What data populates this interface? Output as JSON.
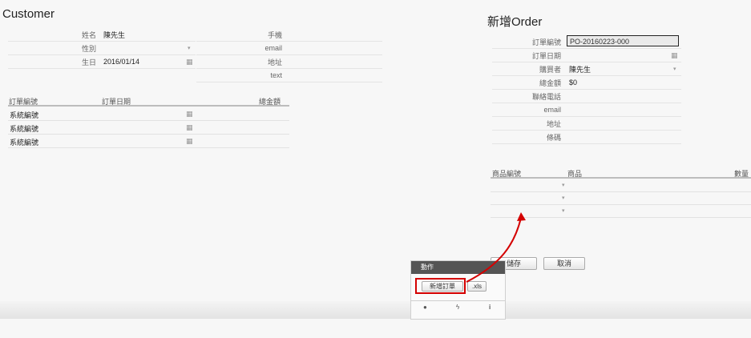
{
  "customer": {
    "title": "Customer",
    "fields_left": [
      {
        "label": "姓名",
        "value": "陳先生"
      },
      {
        "label": "性別",
        "value": ""
      },
      {
        "label": "生日",
        "value": "2016/01/14"
      }
    ],
    "fields_right": [
      "手機",
      "email",
      "地址",
      "text"
    ],
    "orders": {
      "columns": [
        "訂單編號",
        "訂單日期",
        "總金額"
      ],
      "rows": [
        {
          "number": "系統編號",
          "date": "",
          "total": ""
        },
        {
          "number": "系統編號",
          "date": "",
          "total": ""
        },
        {
          "number": "系統編號",
          "date": "",
          "total": ""
        }
      ]
    }
  },
  "new_order": {
    "title": "新增Order",
    "fields": [
      {
        "label": "訂單編號",
        "value": "PO-20160223-000"
      },
      {
        "label": "訂單日期",
        "value": ""
      },
      {
        "label": "購買者",
        "value": "陳先生"
      },
      {
        "label": "總金額",
        "value": "$0"
      },
      {
        "label": "聯絡電話",
        "value": ""
      },
      {
        "label": "email",
        "value": ""
      },
      {
        "label": "地址",
        "value": ""
      },
      {
        "label": "條碼",
        "value": ""
      }
    ],
    "items": {
      "columns": [
        "商品編號",
        "商品",
        "數量"
      ],
      "rows": 3
    },
    "save_label": "儲存",
    "cancel_label": "取消"
  },
  "action_panel": {
    "title": "動作",
    "new_order_button": "新增訂單",
    "xls_button": ".xls"
  },
  "icons": {
    "calendar": "calendar-icon",
    "dropdown": "chevron-down-icon",
    "comment": "comment-icon",
    "bolt": "lightning-icon",
    "info": "info-icon"
  },
  "colors": {
    "highlight": "#d40000",
    "arrow": "#d40000",
    "panel_header": "#555555"
  }
}
